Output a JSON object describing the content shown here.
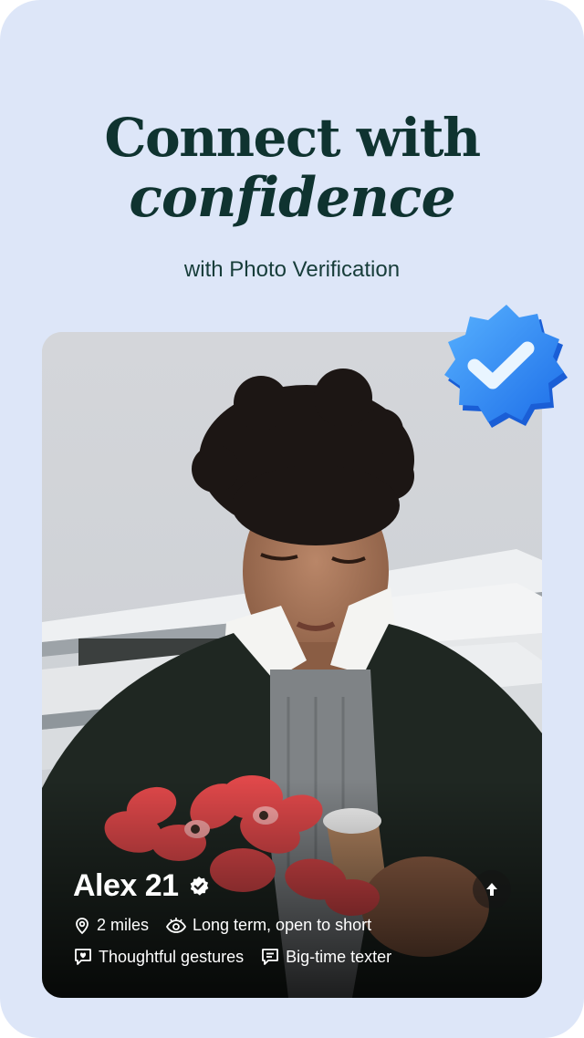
{
  "headline": {
    "line1": "Connect with",
    "line2": "confidence"
  },
  "subtitle": "with Photo Verification",
  "profile": {
    "name_age": "Alex 21",
    "distance": "2 miles",
    "looking_for": "Long term, open to short",
    "prompt_1": "Thoughtful gestures",
    "prompt_2": "Big-time texter"
  },
  "icons": {
    "verified": "verified-check-icon",
    "expand": "arrow-up-icon",
    "location": "location-pin-icon",
    "eye": "eye-icon",
    "speech1": "heart-speech-icon",
    "speech2": "chat-bubble-icon",
    "badge": "verified-badge-3d-icon"
  },
  "colors": {
    "background": "#dde6f8",
    "headline": "#0f3330",
    "badge_blue": "#2f8cf5"
  }
}
